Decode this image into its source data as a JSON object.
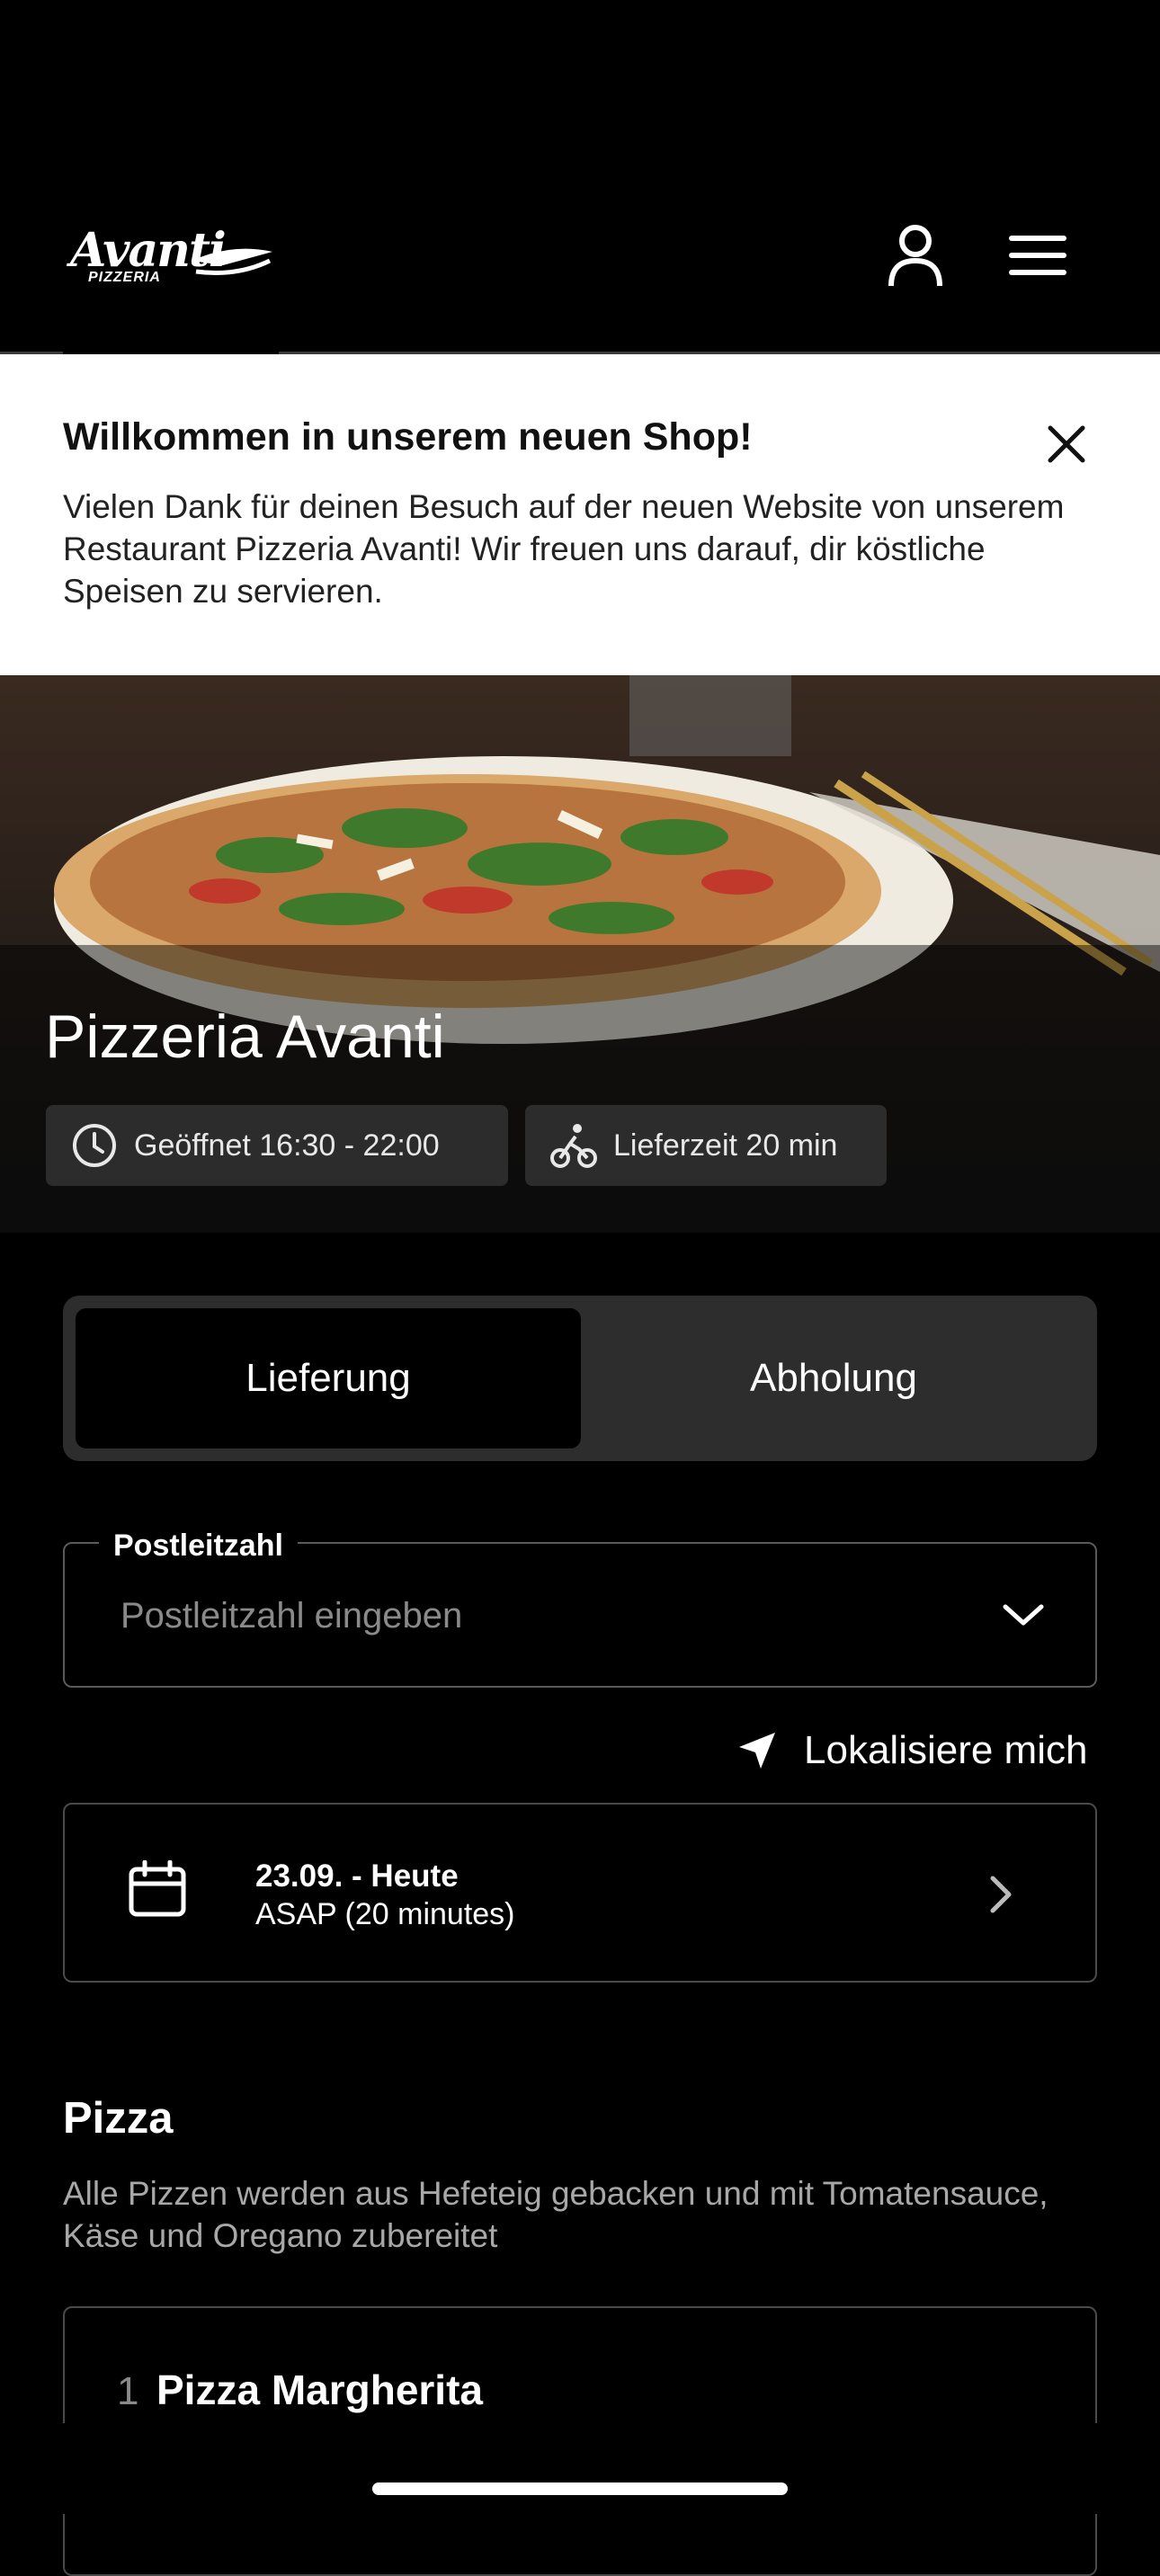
{
  "header": {
    "logo_text": "Avanti",
    "logo_sub": "PIZZERIA",
    "account_icon": "user-icon",
    "menu_icon": "hamburger-icon"
  },
  "banner": {
    "title": "Willkommen in unserem neuen Shop!",
    "body": "Vielen Dank für deinen Besuch auf der neuen Website von unserem Restaurant Pizzeria Avanti! Wir freuen uns darauf, dir köstliche Speisen zu servieren.",
    "close_icon": "close-icon"
  },
  "hero": {
    "title": "Pizzeria Avanti",
    "hours": "Geöffnet 16:30 - 22:00",
    "delivery_time": "Lieferzeit 20 min"
  },
  "order_mode": {
    "options": [
      "Lieferung",
      "Abholung"
    ],
    "selected": "Lieferung"
  },
  "postcode": {
    "label": "Postleitzahl",
    "placeholder": "Postleitzahl eingeben",
    "locate_label": "Lokalisiere mich"
  },
  "schedule": {
    "date": "23.09. - Heute",
    "time": "ASAP (20 minutes)"
  },
  "section": {
    "title": "Pizza",
    "description": "Alle Pizzen werden aus Hefeteig gebacken und mit Tomatensauce, Käse und Oregano zubereitet"
  },
  "items": [
    {
      "number": "1",
      "name": "Pizza Margherita"
    }
  ],
  "colors": {
    "background": "#000000",
    "banner": "#ffffff",
    "toggle_bg": "#2d2d2d",
    "chip_bg": "#2c2c2c",
    "muted_text": "#a8a8a8"
  }
}
